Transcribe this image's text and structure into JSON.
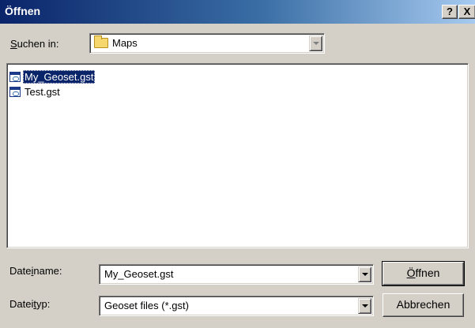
{
  "window": {
    "title": "Öffnen",
    "help_label": "?",
    "close_label": "X"
  },
  "lookin": {
    "label_prefix": "",
    "label_mnemonic": "S",
    "label_suffix": "uchen in:",
    "value": "Maps",
    "icon": "folder-icon"
  },
  "files": [
    {
      "name": "My_Geoset.gst",
      "selected": true,
      "icon": "geoset-file-icon"
    },
    {
      "name": "Test.gst",
      "selected": false,
      "icon": "geoset-file-icon"
    }
  ],
  "filename": {
    "label_prefix": "Date",
    "label_mnemonic": "i",
    "label_suffix": "name:",
    "value": "My_Geoset.gst"
  },
  "filetype": {
    "label_prefix": "Datei",
    "label_mnemonic": "t",
    "label_suffix": "yp:",
    "value": "Geoset files (*.gst)"
  },
  "buttons": {
    "open_prefix": "",
    "open_mnemonic": "Ö",
    "open_suffix": "ffnen",
    "cancel": "Abbrechen"
  },
  "colors": {
    "titlebar_start": "#0a246a",
    "titlebar_end": "#a6caf0",
    "face": "#d4d0c8",
    "selection": "#0a246a"
  }
}
